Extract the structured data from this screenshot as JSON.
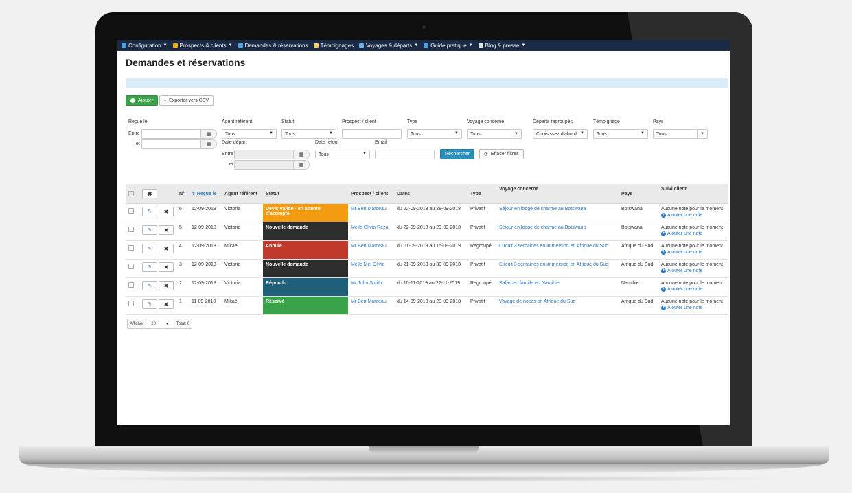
{
  "nav": [
    {
      "label": "Configuration",
      "icon": "gear-icon",
      "caret": true,
      "color": "#4aa3df"
    },
    {
      "label": "Prospects & clients",
      "icon": "users-icon",
      "caret": true,
      "color": "#f0b000"
    },
    {
      "label": "Demandes & réservations",
      "icon": "calendar-icon",
      "caret": false,
      "color": "#4aa3df"
    },
    {
      "label": "Témoignages",
      "icon": "document-icon",
      "caret": false,
      "color": "#f0d070"
    },
    {
      "label": "Voyages & départs",
      "icon": "image-icon",
      "caret": true,
      "color": "#6bb0e0"
    },
    {
      "label": "Guide pratique",
      "icon": "globe-icon",
      "caret": true,
      "color": "#4aa3df"
    },
    {
      "label": "Blog & presse",
      "icon": "comments-icon",
      "caret": true,
      "color": "#e0e0e0"
    }
  ],
  "page": {
    "title": "Demandes et réservations"
  },
  "toolbar": {
    "add_label": "Ajouter",
    "export_label": "Exporter vers CSV"
  },
  "filters": {
    "recue_le": "Reçue le",
    "entre": "Entre",
    "et": "et",
    "agent": {
      "label": "Agent référent",
      "value": "Tous"
    },
    "statut": {
      "label": "Statut",
      "value": "Tous"
    },
    "prospect": {
      "label": "Prospect / client",
      "value": ""
    },
    "type": {
      "label": "Type",
      "value": "Tous"
    },
    "voyage": {
      "label": "Voyage concerné",
      "value": "Tous"
    },
    "departs": {
      "label": "Départs regroupés",
      "value": "Choisissez d'abord"
    },
    "temoignage": {
      "label": "Témoignage",
      "value": "Tous"
    },
    "pays": {
      "label": "Pays",
      "value": "Tous"
    },
    "date_depart": "Date départ",
    "date_retour": {
      "label": "Date retour",
      "value": "Tous"
    },
    "email": {
      "label": "Email",
      "value": ""
    },
    "search_label": "Rechercher",
    "clear_label": "Effacer filtres"
  },
  "table": {
    "headers": {
      "num": "N°",
      "recue": "Reçue le",
      "agent": "Agent référent",
      "statut": "Statut",
      "prospect": "Prospect / client",
      "dates": "Dates",
      "type": "Type",
      "voyage": "Voyage concerné",
      "pays": "Pays",
      "suivi": "Suivi client"
    },
    "rows": [
      {
        "num": "6",
        "recue": "12-09-2018",
        "agent": "Victoria",
        "statut": "Devis validé - en attente d'acompte",
        "statut_color": "#f39c12",
        "prospect": "Mr Ben Marceau",
        "dates": "du 22-09-2018 au 28-09-2018",
        "type": "Privatif",
        "voyage": "Séjour en lodge de charme au Botswana",
        "pays": "Botswana",
        "note": "Aucune note pour le moment",
        "add_note": "Ajouter une note"
      },
      {
        "num": "5",
        "recue": "12-09-2018",
        "agent": "Victoria",
        "statut": "Nouvelle demande",
        "statut_color": "#2d2d2d",
        "prospect": "Melle Olivia Reza",
        "dates": "du 22-09-2018 au 29-09-2018",
        "type": "Privatif",
        "voyage": "Séjour en lodge de charme au Botswana",
        "pays": "Botswana",
        "note": "Aucune note pour le moment",
        "add_note": "Ajouter une note"
      },
      {
        "num": "4",
        "recue": "12-09-2018",
        "agent": "Mikaël",
        "statut": "Annulé",
        "statut_color": "#c0392b",
        "prospect": "Mr Ben Marceau",
        "dates": "du 01-09-2019 au 15-09-2019",
        "type": "Regroupé",
        "voyage": "Circuit 3 semaines en immersion en Afrique du Sud",
        "pays": "Afrique du Sud",
        "note": "Aucune note pour le moment",
        "add_note": "Ajouter une note"
      },
      {
        "num": "3",
        "recue": "12-09-2018",
        "agent": "Victoria",
        "statut": "Nouvelle demande",
        "statut_color": "#2d2d2d",
        "prospect": "Melle Mel Olivia",
        "dates": "du 21-09-2018 au 30-09-2018",
        "type": "Privatif",
        "voyage": "Circuit 3 semaines en immersion en Afrique du Sud",
        "pays": "Afrique du Sud",
        "note": "Aucune note pour le moment",
        "add_note": "Ajouter une note"
      },
      {
        "num": "2",
        "recue": "12-09-2018",
        "agent": "Victoria",
        "statut": "Répondu",
        "statut_color": "#1f5f7a",
        "prospect": "Mr John Smith",
        "dates": "du 10-11-2019 au 22-11-2019",
        "type": "Regroupé",
        "voyage": "Safari en famille en Namibie",
        "pays": "Namibie",
        "note": "Aucune note pour le moment",
        "add_note": "Ajouter une note"
      },
      {
        "num": "1",
        "recue": "11-09-2018",
        "agent": "Mikaël",
        "statut": "Réservé",
        "statut_color": "#3aa34a",
        "prospect": "Mr Ben Marceau",
        "dates": "du 14-09-2018 au 28-09-2018",
        "type": "Privatif",
        "voyage": "Voyage de noces en Afrique du Sud",
        "pays": "Afrique du Sud",
        "note": "Aucune note pour le moment",
        "add_note": "Ajouter une note"
      }
    ]
  },
  "pager": {
    "show_label": "Afficher",
    "per_page": "20",
    "total_label": "Total: 6"
  }
}
